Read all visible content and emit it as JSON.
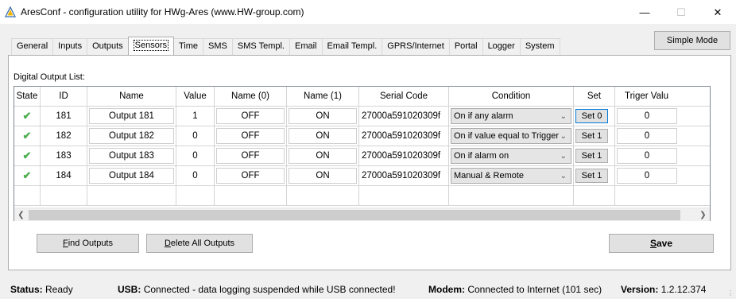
{
  "window": {
    "title": "AresConf - configuration utility for HWg-Ares (www.HW-group.com)",
    "minimize": "—",
    "maximize": "☐",
    "close": "✕"
  },
  "tabs": [
    {
      "label": "General"
    },
    {
      "label": "Inputs"
    },
    {
      "label": "Outputs"
    },
    {
      "label": "Sensors",
      "active": true
    },
    {
      "label": "Time"
    },
    {
      "label": "SMS"
    },
    {
      "label": "SMS Templ."
    },
    {
      "label": "Email"
    },
    {
      "label": "Email Templ."
    },
    {
      "label": "GPRS/Internet"
    },
    {
      "label": "Portal"
    },
    {
      "label": "Logger"
    },
    {
      "label": "System"
    }
  ],
  "simple_mode_label": "Simple Mode",
  "group_label": "Digital Output List:",
  "table": {
    "headers": {
      "state": "State",
      "id": "ID",
      "name": "Name",
      "value": "Value",
      "name0": "Name (0)",
      "name1": "Name (1)",
      "serial": "Serial Code",
      "condition": "Condition",
      "set": "Set",
      "trigger": "Triger Valu"
    },
    "rows": [
      {
        "state": "✔",
        "id": "181",
        "name": "Output 181",
        "value": "1",
        "name0": "OFF",
        "name1": "ON",
        "serial": "27000a591020309f",
        "condition": "On if any alarm",
        "set": "Set 0",
        "trigger": "0"
      },
      {
        "state": "✔",
        "id": "182",
        "name": "Output 182",
        "value": "0",
        "name0": "OFF",
        "name1": "ON",
        "serial": "27000a591020309f",
        "condition": "On if value equal to Trigger",
        "set": "Set 1",
        "trigger": "0"
      },
      {
        "state": "✔",
        "id": "183",
        "name": "Output 183",
        "value": "0",
        "name0": "OFF",
        "name1": "ON",
        "serial": "27000a591020309f",
        "condition": "On if alarm on",
        "set": "Set 1",
        "trigger": "0"
      },
      {
        "state": "✔",
        "id": "184",
        "name": "Output 184",
        "value": "0",
        "name0": "OFF",
        "name1": "ON",
        "serial": "27000a591020309f",
        "condition": "Manual & Remote",
        "set": "Set 1",
        "trigger": "0"
      }
    ]
  },
  "buttons": {
    "find_outputs_u": "F",
    "find_outputs_rest": "ind Outputs",
    "delete_all_u": "D",
    "delete_all_rest": "elete All Outputs",
    "save_u": "S",
    "save_rest": "ave"
  },
  "status": {
    "status_label": "Status:",
    "status_value": "Ready",
    "usb_label": "USB:",
    "usb_value": "Connected - data logging suspended while USB connected!",
    "modem_label": "Modem:",
    "modem_value": "Connected to Internet (101 sec)",
    "version_label": "Version:",
    "version_value": "1.2.12.374"
  },
  "colors": {
    "check": "#4caf50",
    "focus_border": "#0078d7"
  }
}
